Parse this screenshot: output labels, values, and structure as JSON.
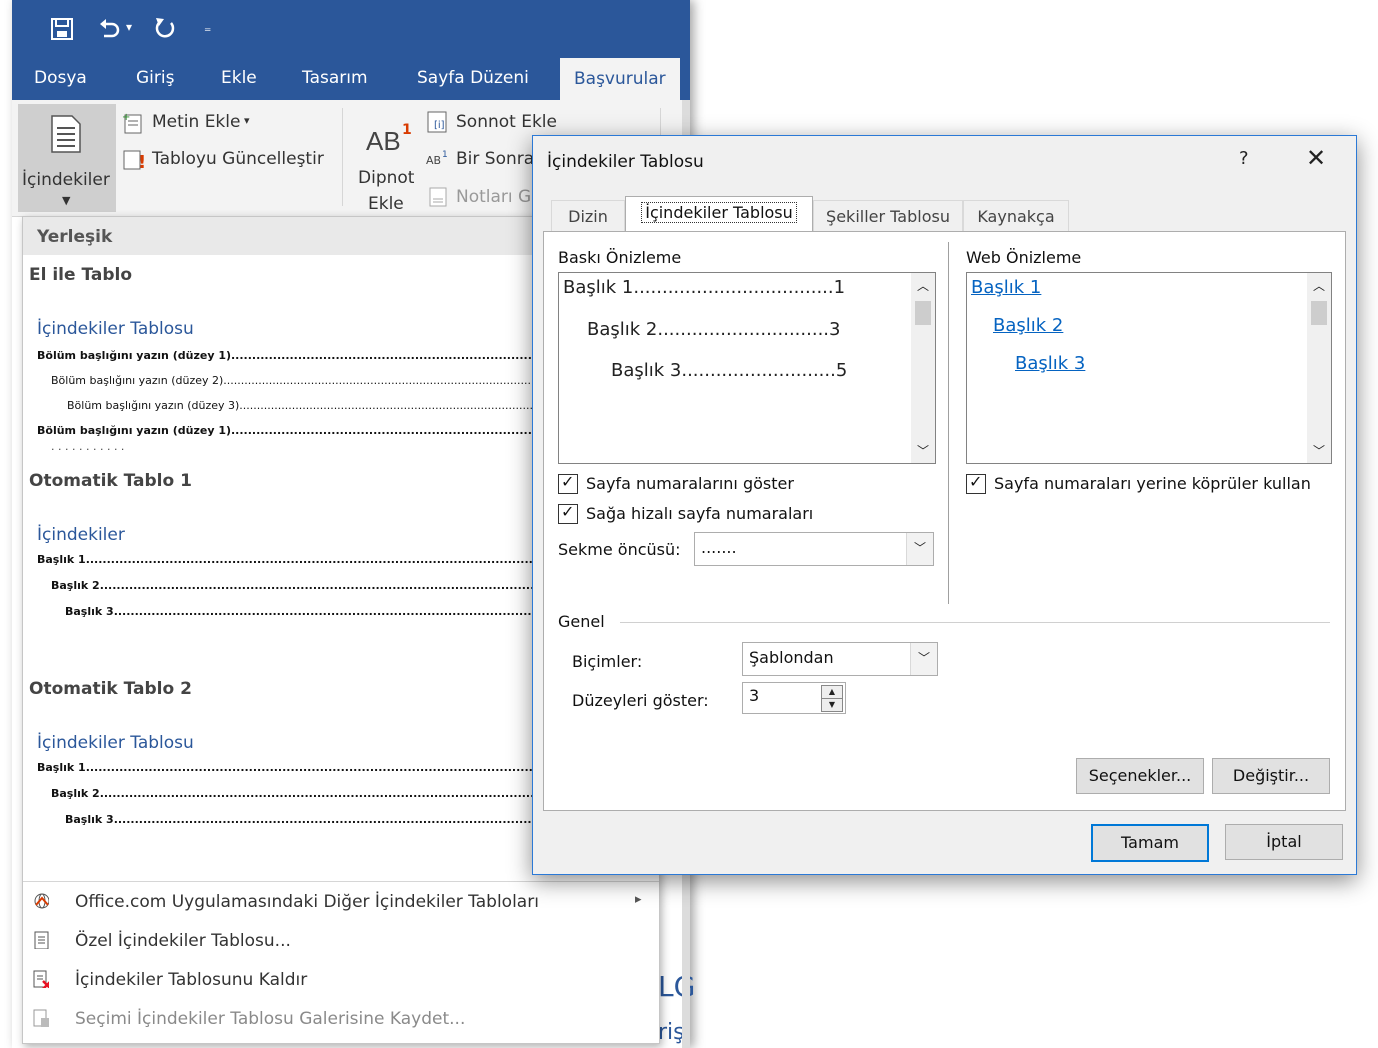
{
  "word": {
    "tabs": [
      "Dosya",
      "Giriş",
      "Ekle",
      "Tasarım",
      "Sayfa Düzeni",
      "Başvurular"
    ],
    "active_tab": "Başvurular",
    "ribbon": {
      "toc_button": "İçindekiler",
      "add_text": "Metin Ekle",
      "update_table": "Tabloyu Güncelleştir",
      "footnote_line1": "Dipnot",
      "footnote_line2": "Ekle",
      "endnote": "Sonnot Ekle",
      "next_footnote": "Bir Sonra",
      "show_notes": "Notları G"
    },
    "partial_text_1": "LG",
    "partial_text_2": "riş"
  },
  "dropdown": {
    "header": "Yerleşik",
    "sections": [
      {
        "name": "El ile Tablo",
        "title": "İçindekiler Tablosu",
        "lines": [
          "Bölüm başlığını yazın (düzey 1)",
          "Bölüm başlığını yazın (düzey 2)",
          "Bölüm başlığını yazın (düzey 3)",
          "Bölüm başlığını yazın (düzey 1)"
        ]
      },
      {
        "name": "Otomatik Tablo 1",
        "title": "İçindekiler",
        "lines": [
          "Başlık 1",
          "Başlık 2",
          "Başlık 3"
        ]
      },
      {
        "name": "Otomatik Tablo 2",
        "title": "İçindekiler Tablosu",
        "lines": [
          "Başlık 1",
          "Başlık 2",
          "Başlık 3"
        ]
      }
    ],
    "menu": [
      {
        "label": "Office.com Uygulamasındaki Diğer İçindekiler Tabloları",
        "submenu": "▸"
      },
      {
        "label": "Özel İçindekiler Tablosu..."
      },
      {
        "label": "İçindekiler Tablosunu Kaldır"
      },
      {
        "label": "Seçimi İçindekiler Tablosu Galerisine Kaydet..."
      }
    ]
  },
  "dialog": {
    "title": "İçindekiler Tablosu",
    "help": "?",
    "close": "✕",
    "tabs": [
      "Dizin",
      "İçindekiler Tablosu",
      "Şekiller Tablosu",
      "Kaynakça"
    ],
    "active_tab": "İçindekiler Tablosu",
    "print_preview_label": "Baskı Önizleme",
    "print_preview": [
      {
        "text": "Başlık 1",
        "dots": "...................................",
        "page": "1"
      },
      {
        "text": "Başlık 2",
        "dots": "..............................",
        "page": "3"
      },
      {
        "text": "Başlık 3",
        "dots": "...........................",
        "page": "5"
      }
    ],
    "web_preview_label": "Web Önizleme",
    "web_preview": [
      "Başlık 1",
      "Başlık 2",
      "Başlık 3"
    ],
    "show_page_numbers": "Sayfa numaralarını göster",
    "right_align": "Sağa hizalı sayfa numaraları",
    "tab_leader_label": "Sekme öncüsü:",
    "tab_leader_value": ".......",
    "use_hyperlinks": "Sayfa numaraları yerine köprüler kullan",
    "general_label": "Genel",
    "formats_label": "Biçimler:",
    "formats_value": "Şablondan",
    "levels_label": "Düzeyleri göster:",
    "levels_value": "3",
    "options_button": "Seçenekler...",
    "modify_button": "Değiştir...",
    "ok_button": "Tamam",
    "cancel_button": "İptal"
  }
}
